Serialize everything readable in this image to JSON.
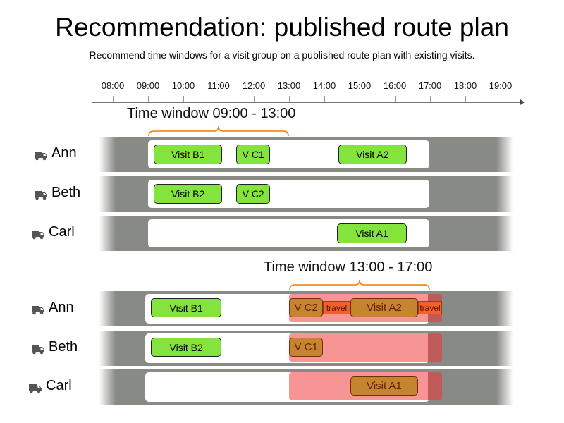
{
  "header": {
    "title": "Recommendation: published route plan",
    "subtitle": "Recommend time windows for a visit group on a published route plan with existing visits."
  },
  "axis": {
    "ticks": [
      "08:00",
      "09:00",
      "10:00",
      "11:00",
      "12:00",
      "13:00",
      "14:00",
      "15:00",
      "16:00",
      "17:00",
      "18:00",
      "19:00"
    ]
  },
  "colors": {
    "lane": "#888a85",
    "visit_existing": "#84e33c",
    "visit_recommended": "#c5842e",
    "travel": "#f0612c",
    "window_overlay": "#f79595",
    "bracket": "#f57900"
  },
  "groups": [
    {
      "time_window_label": "Time window 09:00 - 13:00",
      "window": [
        "09:00",
        "13:00"
      ],
      "rows": [
        {
          "driver": "Ann",
          "icon": "truck-icon",
          "visits": [
            {
              "label": "Visit B1",
              "start": "09:10",
              "end": "11:06",
              "kind": "existing"
            },
            {
              "label": "V C1",
              "start": "11:30",
              "end": "12:28",
              "kind": "existing"
            },
            {
              "label": "Visit A2",
              "start": "14:24",
              "end": "16:20",
              "kind": "existing"
            }
          ]
        },
        {
          "driver": "Beth",
          "icon": "truck-icon",
          "visits": [
            {
              "label": "Visit B2",
              "start": "09:10",
              "end": "11:06",
              "kind": "existing"
            },
            {
              "label": "V C2",
              "start": "11:30",
              "end": "12:28",
              "kind": "existing"
            }
          ]
        },
        {
          "driver": "Carl",
          "icon": "truck-icon",
          "visits": [
            {
              "label": "Visit A1",
              "start": "14:22",
              "end": "16:20",
              "kind": "existing"
            }
          ]
        }
      ]
    },
    {
      "time_window_label": "Time window 13:00 - 17:00",
      "window": [
        "13:00",
        "17:00"
      ],
      "rows": [
        {
          "driver": "Ann",
          "icon": "truck-icon",
          "visits": [
            {
              "label": "Visit B1",
              "start": "09:05",
              "end": "11:05",
              "kind": "existing"
            },
            {
              "label": "V C2",
              "start": "13:00",
              "end": "13:58",
              "kind": "recommended"
            },
            {
              "label": "travel",
              "start": "13:58",
              "end": "14:44",
              "kind": "travel"
            },
            {
              "label": "Visit A2",
              "start": "14:44",
              "end": "16:40",
              "kind": "recommended"
            },
            {
              "label": "travel",
              "start": "16:40",
              "end": "17:20",
              "kind": "travel"
            }
          ]
        },
        {
          "driver": "Beth",
          "icon": "truck-icon",
          "visits": [
            {
              "label": "Visit B2",
              "start": "09:05",
              "end": "11:05",
              "kind": "existing"
            },
            {
              "label": "V C1",
              "start": "13:00",
              "end": "13:58",
              "kind": "recommended"
            }
          ]
        },
        {
          "driver": "Carl",
          "icon": "truck-icon",
          "visits": [
            {
              "label": "Visit A1",
              "start": "14:44",
              "end": "16:40",
              "kind": "recommended"
            }
          ]
        }
      ]
    }
  ]
}
